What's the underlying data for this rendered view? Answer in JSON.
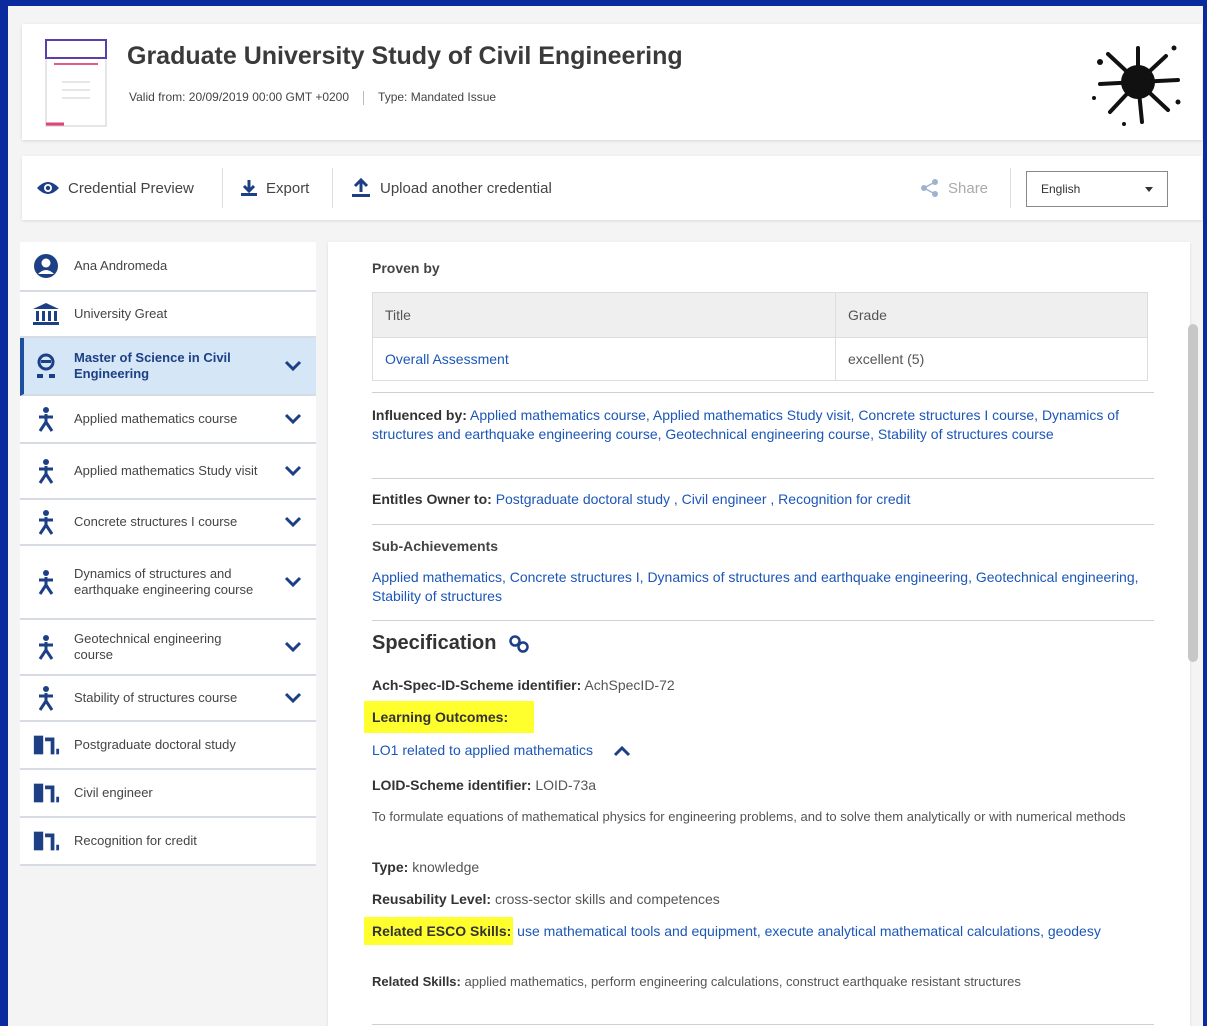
{
  "header": {
    "title": "Graduate University Study of Civil Engineering",
    "valid_from": "Valid from: 20/09/2019 00:00 GMT +0200",
    "type": "Type: Mandated Issue"
  },
  "toolbar": {
    "preview": "Credential Preview",
    "export": "Export",
    "upload": "Upload another credential",
    "share": "Share",
    "language": "English"
  },
  "sidebar": {
    "items": [
      {
        "label": "Ana Andromeda",
        "icon": "user-circle-icon"
      },
      {
        "label": "University Great",
        "icon": "university-icon"
      },
      {
        "label": "Master of Science in Civil Engineering",
        "icon": "graduate-icon"
      },
      {
        "label": "Applied mathematics course",
        "icon": "person-activity-icon"
      },
      {
        "label": "Applied mathematics Study visit",
        "icon": "person-activity-icon"
      },
      {
        "label": "Concrete structures I course",
        "icon": "person-activity-icon"
      },
      {
        "label": "Dynamics of structures and earthquake engineering course",
        "icon": "person-activity-icon"
      },
      {
        "label": "Geotechnical engineering course",
        "icon": "person-activity-icon"
      },
      {
        "label": "Stability of structures course",
        "icon": "person-activity-icon"
      },
      {
        "label": "Postgraduate doctoral study",
        "icon": "entitlement-icon"
      },
      {
        "label": "Civil engineer",
        "icon": "entitlement-icon"
      },
      {
        "label": "Recognition for credit",
        "icon": "entitlement-icon"
      }
    ]
  },
  "main": {
    "proven_by": "Proven by",
    "table": {
      "headers": [
        "Title",
        "Grade"
      ],
      "rows": [
        [
          "Overall Assessment",
          "excellent (5)"
        ]
      ]
    },
    "influenced_label": "Influenced by:",
    "influenced_text": "Applied mathematics course, Applied mathematics Study visit, Concrete structures I course, Dynamics of structures and earthquake engineering course, Geotechnical engineering course, Stability of structures course",
    "entitles_label": "Entitles Owner to:",
    "entitles_text": "Postgraduate doctoral study , Civil engineer , Recognition for credit",
    "sub_title": "Sub-Achievements",
    "sub_text": "Applied mathematics, Concrete structures I, Dynamics of structures and earthquake engineering, Geotechnical engineering, Stability of structures",
    "spec_title": "Specification",
    "scheme_label": "Ach-Spec-ID-Scheme identifier:",
    "scheme_value": "AchSpecID-72",
    "lo_label": "Learning Outcomes:",
    "lo_link": "LO1 related to applied mathematics",
    "loid_label": "LOID-Scheme identifier:",
    "loid_value": "LOID-73a",
    "lo_description": "To formulate equations of mathematical physics for engineering problems, and to solve them analytically or with numerical methods",
    "type_label": "Type:",
    "type_value": "knowledge",
    "reuse_label": "Reusability Level:",
    "reuse_value": "cross-sector skills and competences",
    "esco_label": "Related ESCO Skills:",
    "esco_value": "use mathematical tools and equipment, execute analytical mathematical calculations, geodesy",
    "skills_label": "Related Skills:",
    "skills_value": "applied mathematics, perform engineering calculations, construct earthquake resistant structures"
  }
}
